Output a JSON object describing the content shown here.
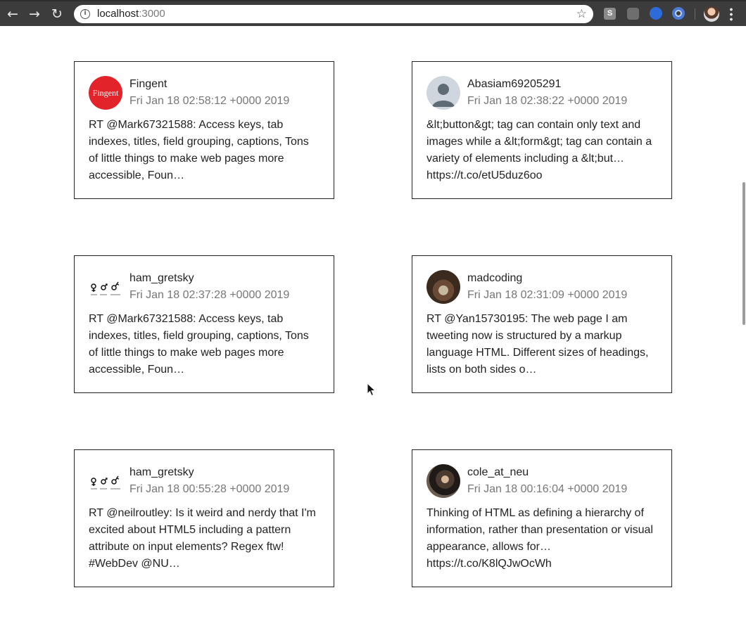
{
  "browser": {
    "url_host": "localhost",
    "url_port": ":3000",
    "back_icon": "arrow-left-icon",
    "forward_icon": "arrow-right-icon",
    "reload_icon": "reload-icon",
    "info_icon": "info-icon",
    "bookmark_icon": "star-icon",
    "extensions": [
      {
        "name": "s-extension-icon",
        "glyph": "S"
      },
      {
        "name": "bulb-extension-icon",
        "glyph": "💡"
      },
      {
        "name": "blue-extension-icon",
        "glyph": "i"
      },
      {
        "name": "ring-extension-icon",
        "glyph": ""
      }
    ],
    "profile_icon": "profile-avatar"
  },
  "tweets": [
    {
      "username": "Fingent",
      "timestamp": "Fri Jan 18 02:58:12 +0000 2019",
      "text": "RT @Mark67321588: Access keys, tab indexes, titles, field grouping, captions, Tons of little things to make web pages more accessible, Foun…",
      "avatar_label": "Fingent",
      "avatar_color": "#e2232a"
    },
    {
      "username": "Abasiam69205291",
      "timestamp": "Fri Jan 18 02:38:22 +0000 2019",
      "text": "&lt;button&gt; tag can contain only text and images while a &lt;form&gt; tag can contain a variety of elements including a &lt;but… https://t.co/etU5duz6oo",
      "avatar_color": "#cfd6dd"
    },
    {
      "username": "ham_gretsky",
      "timestamp": "Fri Jan 18 02:37:28 +0000 2019",
      "text": "RT @Mark67321588: Access keys, tab indexes, titles, field grouping, captions, Tons of little things to make web pages more accessible, Foun…"
    },
    {
      "username": "madcoding",
      "timestamp": "Fri Jan 18 02:31:09 +0000 2019",
      "text": "RT @Yan15730195: The web page I am tweeting now is structured by a markup language HTML. Different sizes of headings, lists on both sides o…"
    },
    {
      "username": "ham_gretsky",
      "timestamp": "Fri Jan 18 00:55:28 +0000 2019",
      "text": "RT @neilroutley: Is it weird and nerdy that I'm excited about HTML5 including a pattern attribute on input elements? Regex ftw! #WebDev @NU…"
    },
    {
      "username": "cole_at_neu",
      "timestamp": "Fri Jan 18 00:16:04 +0000 2019",
      "text": "Thinking of HTML as defining a hierarchy of information, rather than presentation or visual appearance, allows for… https://t.co/K8lQJwOcWh"
    }
  ]
}
